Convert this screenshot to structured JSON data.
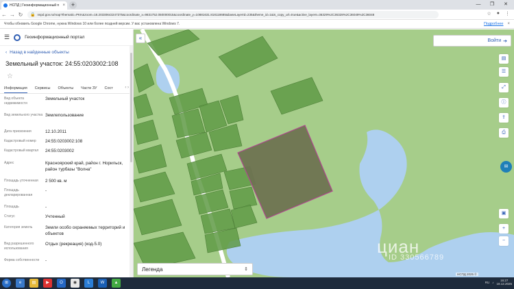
{
  "browser": {
    "tab_title": "НСПД | Геоинформационный п",
    "tab_close": "×",
    "new_tab": "+",
    "url": "nspd.gov.ru/map?thematic=PKK&zoom=18.20330643247375&coordinate_x=9831752.050000015&coordinate_y=10881631.818118685&baseLayerId=235&theme_id=1&is_copy_url=true&active_layers=36329%2C36328%2C36049%2C36048",
    "infobar_message": "Чтобы обновить Google Chrome, нужна Windows 10 или более поздней версии. У вас установлена Windows 7.",
    "infobar_link": "Подробнее",
    "infobar_close": "×"
  },
  "panel": {
    "portal_name": "Геоинформационный портал",
    "back_label": "Назад в найденные объекты",
    "object_title": "Земельный участок: 24:55:0203002:108",
    "tabs": [
      "Информация",
      "Сервисы",
      "Объекты",
      "Части ЗУ",
      "Сост"
    ],
    "properties": [
      {
        "key": "Вид объекта недвижимости",
        "value": "Земельный участок"
      },
      {
        "key": "Вид земельного участка",
        "value": "Землепользование"
      },
      {
        "key": "Дата присвоения",
        "value": "12.10.2011"
      },
      {
        "key": "Кадастровый номер",
        "value": "24:55:0203002:108"
      },
      {
        "key": "Кадастровый квартал",
        "value": "24:55:0203002"
      },
      {
        "key": "Адрес",
        "value": "Красноярский край, район г. Норильск, район турбазы \"Волна\""
      },
      {
        "key": "Площадь уточненная",
        "value": "2 500 кв. м"
      },
      {
        "key": "Площадь декларированная",
        "value": "-"
      },
      {
        "key": "Площадь",
        "value": "-"
      },
      {
        "key": "Статус",
        "value": "Учтенный"
      },
      {
        "key": "Категория земель",
        "value": "Земли особо охраняемых территорий и объектов"
      },
      {
        "key": "Вид разрешенного использования",
        "value": "Отдых (рекреация) (код-5.0)"
      },
      {
        "key": "Форма собственности",
        "value": "-"
      }
    ]
  },
  "map": {
    "login_label": "Войти",
    "legend_label": "Легенда",
    "watermark": "циан",
    "watermark_id": "ID 330566789",
    "scale_label": "НСПД 2025 ©",
    "colors": {
      "background": "#a6cd8a",
      "water": "#aed0ef",
      "parcel": "#5f9a45",
      "selected_parcel": "#6e7351",
      "selected_border": "#b0478f",
      "road": "#ffffff"
    }
  },
  "taskbar": {
    "time": "16:27",
    "date": "18.12.2025",
    "lang": "RU"
  }
}
